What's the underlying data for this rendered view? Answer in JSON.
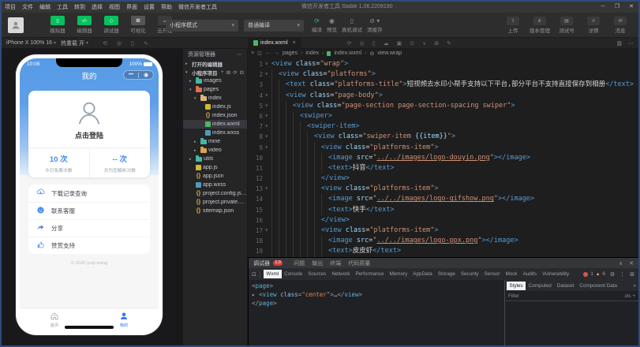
{
  "titlebar": {
    "menus": [
      "项目",
      "文件",
      "编辑",
      "工具",
      "转到",
      "选择",
      "视图",
      "界面",
      "设置",
      "帮助",
      "微信开发者工具"
    ],
    "title": "微信开发者工具 Stable 1.06.2209190",
    "minimize": "─",
    "maximize": "❐",
    "close": "✕"
  },
  "toolbar": {
    "left_buttons": [
      {
        "label": "模拟器",
        "icon": "simulator-icon",
        "style": "green"
      },
      {
        "label": "编辑器",
        "icon": "editor-icon",
        "style": "green"
      },
      {
        "label": "调试器",
        "icon": "debugger-icon",
        "style": "green"
      },
      {
        "label": "可视化",
        "icon": "visual-icon",
        "style": "gray"
      },
      {
        "label": "云开发",
        "icon": "cloud-icon",
        "style": "dim"
      }
    ],
    "mode_select": "小程序模式",
    "compile_select": "普通编译",
    "actions": [
      {
        "label": "编译",
        "icon": "compile-icon",
        "accent": true
      },
      {
        "label": "预览",
        "icon": "preview-icon"
      },
      {
        "label": "真机调试",
        "icon": "device-debug-icon"
      },
      {
        "label": "清缓存",
        "icon": "clear-cache-icon",
        "caret": "▾"
      }
    ],
    "right_buttons": [
      {
        "label": "上传",
        "icon": "upload-icon"
      },
      {
        "label": "版本管理",
        "icon": "version-icon"
      },
      {
        "label": "测试号",
        "icon": "test-icon"
      },
      {
        "label": "详情",
        "icon": "details-icon"
      },
      {
        "label": "消息",
        "icon": "message-icon"
      }
    ]
  },
  "simulator": {
    "device": "iPhone X 100% 16",
    "hot_reload": "热重载 开",
    "toolbar_icons": [
      "rotate-icon",
      "record-icon",
      "device-frame-icon",
      "network-icon"
    ],
    "phone": {
      "time": "10:08",
      "battery": "100%",
      "nav_title": "我的",
      "capsule": "•••",
      "login_text": "点击登陆",
      "stats": [
        {
          "value": "10 次",
          "label": "今日免费次数"
        },
        {
          "value": "-- 次",
          "label": "共为您解析次数"
        }
      ],
      "menu": [
        {
          "icon": "cloud-download-icon",
          "label": "下载记录查询"
        },
        {
          "icon": "contact-icon",
          "label": "联系客服"
        },
        {
          "icon": "share-icon",
          "label": "分享"
        },
        {
          "icon": "thumbs-up-icon",
          "label": "赞赏支持"
        }
      ],
      "copyright": "© 2020 yuqi wang",
      "tabbar": [
        {
          "icon": "home-icon",
          "label": "首页",
          "active": false
        },
        {
          "icon": "user-icon",
          "label": "我的",
          "active": true
        }
      ]
    }
  },
  "explorer": {
    "title": "资源管理器",
    "menu_icon": "⋯",
    "open_editors": "打开的编辑器",
    "project": "小程序项目",
    "section_icons": [
      "new-file-icon",
      "new-folder-icon",
      "refresh-icon",
      "collapse-icon"
    ],
    "tree": [
      {
        "label": "images",
        "ind": 1,
        "arrow": "▸",
        "icon": "folder",
        "color": "#45b8a5"
      },
      {
        "label": "pages",
        "ind": 1,
        "arrow": "▾",
        "icon": "folder",
        "color": "#e06c4f"
      },
      {
        "label": "index",
        "ind": 2,
        "arrow": "▾",
        "icon": "folder",
        "color": "#dcb67a"
      },
      {
        "label": "index.js",
        "ind": 3,
        "icon": "js"
      },
      {
        "label": "index.json",
        "ind": 3,
        "icon": "json"
      },
      {
        "label": "index.wxml",
        "ind": 3,
        "icon": "wxml",
        "selected": true
      },
      {
        "label": "index.wxss",
        "ind": 3,
        "icon": "wxss"
      },
      {
        "label": "mine",
        "ind": 2,
        "arrow": "▸",
        "icon": "folder",
        "color": "#45b8a5"
      },
      {
        "label": "video",
        "ind": 2,
        "arrow": "▸",
        "icon": "folder",
        "color": "#e0a24f"
      },
      {
        "label": "utils",
        "ind": 1,
        "arrow": "▸",
        "icon": "folder",
        "color": "#45b8a5"
      },
      {
        "label": "app.js",
        "ind": 1,
        "icon": "js"
      },
      {
        "label": "app.json",
        "ind": 1,
        "icon": "json"
      },
      {
        "label": "app.wxss",
        "ind": 1,
        "icon": "wxss"
      },
      {
        "label": "project.config.json",
        "ind": 1,
        "icon": "json"
      },
      {
        "label": "project.private.config.json",
        "ind": 1,
        "icon": "json"
      },
      {
        "label": "sitemap.json",
        "ind": 1,
        "icon": "json"
      }
    ]
  },
  "editor": {
    "tab": "index.wxml",
    "tab_icons": [
      "refresh-icon",
      "target-icon",
      "device-icon",
      "cloud-outline-icon",
      "split-icon",
      "search-icon",
      "branch-icon",
      "grid-icon",
      "edit-icon"
    ],
    "breadcrumb": [
      "pages",
      "index",
      "index.wxml",
      "view.wrap"
    ],
    "lines": [
      {
        "n": 1,
        "i": 0,
        "f": true,
        "s": [
          [
            "t",
            "<view"
          ],
          [
            "a",
            " class"
          ],
          [
            "e",
            "="
          ],
          [
            "s",
            "\"wrap\""
          ],
          [
            "t",
            ">"
          ]
        ]
      },
      {
        "n": 2,
        "i": 1,
        "f": true,
        "s": [
          [
            "t",
            "<view"
          ],
          [
            "a",
            " class"
          ],
          [
            "e",
            "="
          ],
          [
            "s",
            "\"platforms\""
          ],
          [
            "t",
            ">"
          ]
        ]
      },
      {
        "n": 3,
        "i": 2,
        "f": false,
        "s": [
          [
            "t",
            "<text"
          ],
          [
            "a",
            " class"
          ],
          [
            "e",
            "="
          ],
          [
            "s",
            "\"platforms-title\""
          ],
          [
            "t",
            ">"
          ],
          [
            "x",
            "短视频去水印小帮手支持以下平台,部分平台不支持直接保存到相册"
          ],
          [
            "t",
            "</text>"
          ]
        ]
      },
      {
        "n": 4,
        "i": 2,
        "f": true,
        "s": [
          [
            "t",
            "<view"
          ],
          [
            "a",
            " class"
          ],
          [
            "e",
            "="
          ],
          [
            "s",
            "\"page-body\""
          ],
          [
            "t",
            ">"
          ]
        ]
      },
      {
        "n": 5,
        "i": 3,
        "f": true,
        "s": [
          [
            "t",
            "<view"
          ],
          [
            "a",
            " class"
          ],
          [
            "e",
            "="
          ],
          [
            "s",
            "\"page-section page-section-spacing swiper\""
          ],
          [
            "t",
            ">"
          ]
        ]
      },
      {
        "n": 6,
        "i": 4,
        "f": true,
        "s": [
          [
            "t",
            "<swiper>"
          ]
        ]
      },
      {
        "n": 7,
        "i": 5,
        "f": true,
        "s": [
          [
            "t",
            "<swiper-item>"
          ]
        ]
      },
      {
        "n": 8,
        "i": 6,
        "f": true,
        "s": [
          [
            "t",
            "<view"
          ],
          [
            "a",
            " class"
          ],
          [
            "e",
            "="
          ],
          [
            "s",
            "\"swiper-item "
          ],
          [
            "m",
            "{{item}}"
          ],
          [
            "s",
            "\""
          ],
          [
            "t",
            ">"
          ]
        ]
      },
      {
        "n": 9,
        "i": 7,
        "f": true,
        "s": [
          [
            "t",
            "<view"
          ],
          [
            "a",
            " class"
          ],
          [
            "e",
            "="
          ],
          [
            "s",
            "\"platforms-item\""
          ],
          [
            "t",
            ">"
          ]
        ]
      },
      {
        "n": 10,
        "i": 8,
        "f": false,
        "s": [
          [
            "t",
            "<image"
          ],
          [
            "a",
            " src"
          ],
          [
            "e",
            "="
          ],
          [
            "s",
            "\""
          ],
          [
            "l",
            "../../images/logo-douyin.png"
          ],
          [
            "s",
            "\""
          ],
          [
            "t",
            "></image>"
          ]
        ]
      },
      {
        "n": 11,
        "i": 8,
        "f": false,
        "s": [
          [
            "t",
            "<text>"
          ],
          [
            "x",
            "抖音"
          ],
          [
            "t",
            "</text>"
          ]
        ]
      },
      {
        "n": 12,
        "i": 7,
        "f": false,
        "s": [
          [
            "t",
            "</view>"
          ]
        ]
      },
      {
        "n": 13,
        "i": 7,
        "f": true,
        "s": [
          [
            "t",
            "<view"
          ],
          [
            "a",
            " class"
          ],
          [
            "e",
            "="
          ],
          [
            "s",
            "\"platforms-item\""
          ],
          [
            "t",
            ">"
          ]
        ]
      },
      {
        "n": 14,
        "i": 8,
        "f": false,
        "s": [
          [
            "t",
            "<image"
          ],
          [
            "a",
            " src"
          ],
          [
            "e",
            "="
          ],
          [
            "s",
            "\""
          ],
          [
            "l",
            "../../images/logo-gifshow.png"
          ],
          [
            "s",
            "\""
          ],
          [
            "t",
            "></image>"
          ]
        ]
      },
      {
        "n": 15,
        "i": 8,
        "f": false,
        "s": [
          [
            "t",
            "<text>"
          ],
          [
            "x",
            "快手"
          ],
          [
            "t",
            "</text>"
          ]
        ]
      },
      {
        "n": 16,
        "i": 7,
        "f": false,
        "s": [
          [
            "t",
            "</view>"
          ]
        ]
      },
      {
        "n": 17,
        "i": 7,
        "f": true,
        "s": [
          [
            "t",
            "<view"
          ],
          [
            "a",
            " class"
          ],
          [
            "e",
            "="
          ],
          [
            "s",
            "\"platforms-item\""
          ],
          [
            "t",
            ">"
          ]
        ]
      },
      {
        "n": 18,
        "i": 8,
        "f": false,
        "s": [
          [
            "t",
            "<image"
          ],
          [
            "a",
            " src"
          ],
          [
            "e",
            "="
          ],
          [
            "s",
            "\""
          ],
          [
            "l",
            "../../images/logo-ppx.png"
          ],
          [
            "s",
            "\""
          ],
          [
            "t",
            "></image>"
          ]
        ]
      },
      {
        "n": 19,
        "i": 8,
        "f": false,
        "s": [
          [
            "t",
            "<text>"
          ],
          [
            "x",
            "皮皮虾"
          ],
          [
            "t",
            "</text>"
          ]
        ]
      }
    ]
  },
  "debugger": {
    "panel_title": "调试器",
    "badge": "1.0",
    "panel_tabs": [
      "问题",
      "输出",
      "终端",
      "代码质量"
    ],
    "devtools_tabs": [
      "Wxml",
      "Console",
      "Sources",
      "Network",
      "Performance",
      "Memory",
      "AppData",
      "Storage",
      "Security",
      "Sensor",
      "Mock",
      "Audits",
      "Vulnerability"
    ],
    "active_tab": "Wxml",
    "errors": "1",
    "warnings": "6",
    "elements": [
      [
        [
          "ep",
          "<"
        ],
        [
          "et",
          "page"
        ],
        [
          "ep",
          ">"
        ]
      ],
      [
        [
          "earr",
          "▸ "
        ],
        [
          "ep",
          "<"
        ],
        [
          "et",
          "view"
        ],
        [
          "ea",
          " class"
        ],
        [
          "ep",
          "=\""
        ],
        [
          "ev",
          "center"
        ],
        [
          "ep",
          "\">"
        ],
        [
          "ed",
          "…"
        ],
        [
          "ep",
          "</"
        ],
        [
          "et",
          "view"
        ],
        [
          "ep",
          ">"
        ]
      ],
      [
        [
          "ep",
          "</"
        ],
        [
          "et",
          "page"
        ],
        [
          "ep",
          ">"
        ]
      ]
    ],
    "styles_tabs": [
      "Styles",
      "Computed",
      "Dataset",
      "Component Data"
    ],
    "active_styles_tab": "Styles",
    "filter_placeholder": "Filter",
    "cls_label": ".cls",
    "add_label": "+"
  }
}
